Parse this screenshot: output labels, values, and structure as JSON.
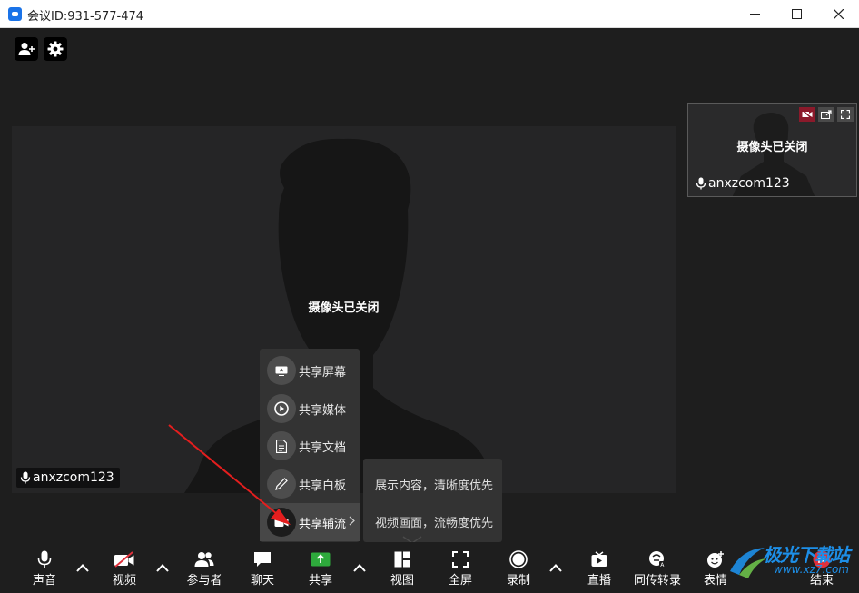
{
  "window": {
    "title": "会议ID:931-577-474",
    "buttons": {
      "minimize": "minimize-icon",
      "maximize": "maximize-icon",
      "close": "close-icon"
    }
  },
  "top_tools": [
    {
      "name": "invite",
      "icon": "add-user-icon"
    },
    {
      "name": "settings",
      "icon": "gear-icon"
    }
  ],
  "main_video": {
    "status": "摄像头已关闭",
    "participant": "anxzcom123"
  },
  "thumbnail": {
    "status": "摄像头已关闭",
    "participant": "anxzcom123",
    "controls": [
      "camera-off-icon",
      "share-out-icon",
      "expand-icon"
    ],
    "accent": "#8b1a2b"
  },
  "share_menu": {
    "items": [
      {
        "label": "共享屏幕",
        "icon": "screen-share-icon"
      },
      {
        "label": "共享媒体",
        "icon": "play-icon"
      },
      {
        "label": "共享文档",
        "icon": "document-icon"
      },
      {
        "label": "共享白板",
        "icon": "pen-icon"
      },
      {
        "label": "共享辅流",
        "icon": "camera-icon",
        "active": true
      }
    ],
    "submenu": [
      "展示内容，清晰度优先",
      "视频画面，流畅度优先"
    ]
  },
  "toolbar": {
    "items": [
      {
        "label": "声音",
        "icon": "mic-icon"
      },
      {
        "label": "视频",
        "icon": "video-off-icon"
      },
      {
        "label": "参与者",
        "icon": "participants-icon"
      },
      {
        "label": "聊天",
        "icon": "chat-icon"
      },
      {
        "label": "共享",
        "icon": "share-icon"
      },
      {
        "label": "视图",
        "icon": "layout-icon"
      },
      {
        "label": "全屏",
        "icon": "fullscreen-icon"
      },
      {
        "label": "录制",
        "icon": "record-icon"
      },
      {
        "label": "直播",
        "icon": "live-icon"
      },
      {
        "label": "同传转录",
        "icon": "transcribe-icon"
      },
      {
        "label": "表情",
        "icon": "emoji-icon"
      },
      {
        "label": "结束",
        "icon": "end-icon"
      }
    ],
    "share_accent": "#2eaa3c",
    "end_accent": "#e0303b"
  },
  "watermark": {
    "text": "极光下载站",
    "url": "www.xz7.com"
  }
}
